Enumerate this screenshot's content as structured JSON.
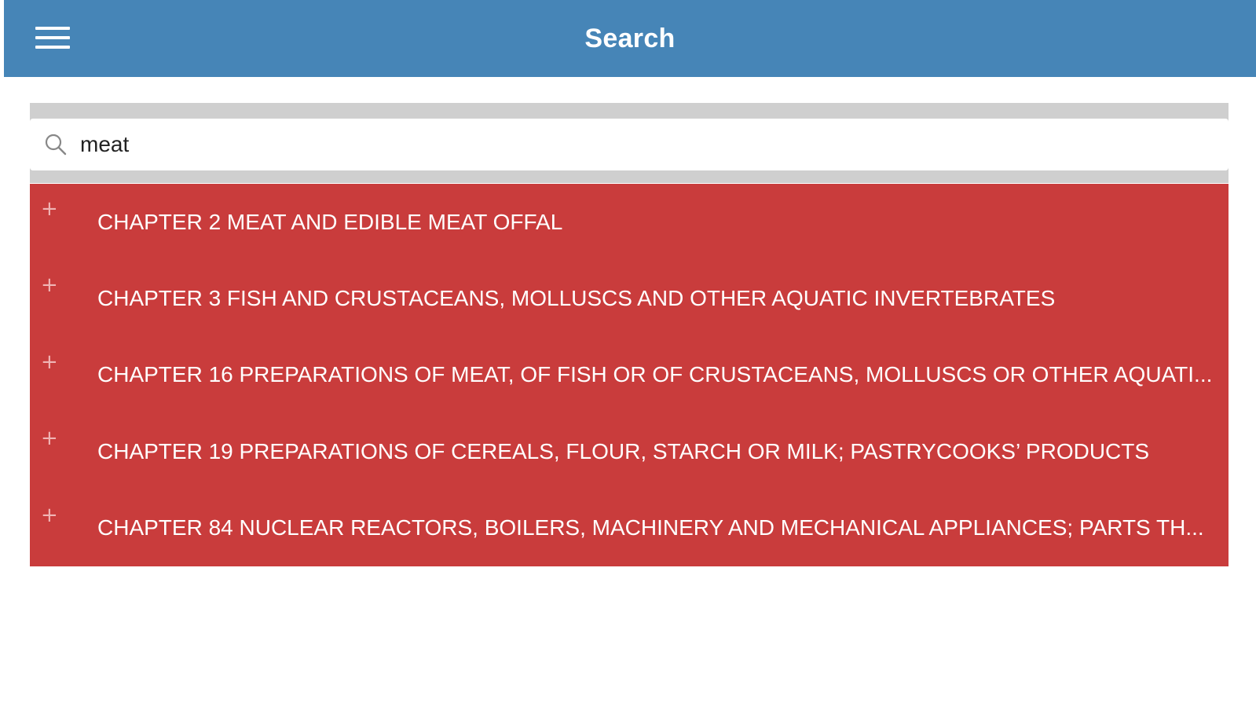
{
  "header": {
    "title": "Search",
    "menu_icon": "hamburger-menu-icon",
    "background_color": "#4685b7"
  },
  "search": {
    "icon": "search-icon",
    "value": "meat",
    "placeholder": ""
  },
  "results": {
    "background_color": "#c93c3c",
    "expand_icon": "plus-icon",
    "items": [
      {
        "label": "CHAPTER 2 MEAT AND EDIBLE MEAT OFFAL"
      },
      {
        "label": "CHAPTER 3 FISH AND CRUSTACEANS, MOLLUSCS AND OTHER AQUATIC INVERTEBRATES"
      },
      {
        "label": "CHAPTER 16 PREPARATIONS OF MEAT, OF FISH OR OF CRUSTACEANS, MOLLUSCS OR OTHER AQUATI..."
      },
      {
        "label": "CHAPTER 19 PREPARATIONS OF CEREALS, FLOUR, STARCH OR MILK; PASTRYCOOKS’ PRODUCTS"
      },
      {
        "label": "CHAPTER 84 NUCLEAR REACTORS, BOILERS, MACHINERY AND MECHANICAL APPLIANCES; PARTS TH..."
      }
    ]
  }
}
